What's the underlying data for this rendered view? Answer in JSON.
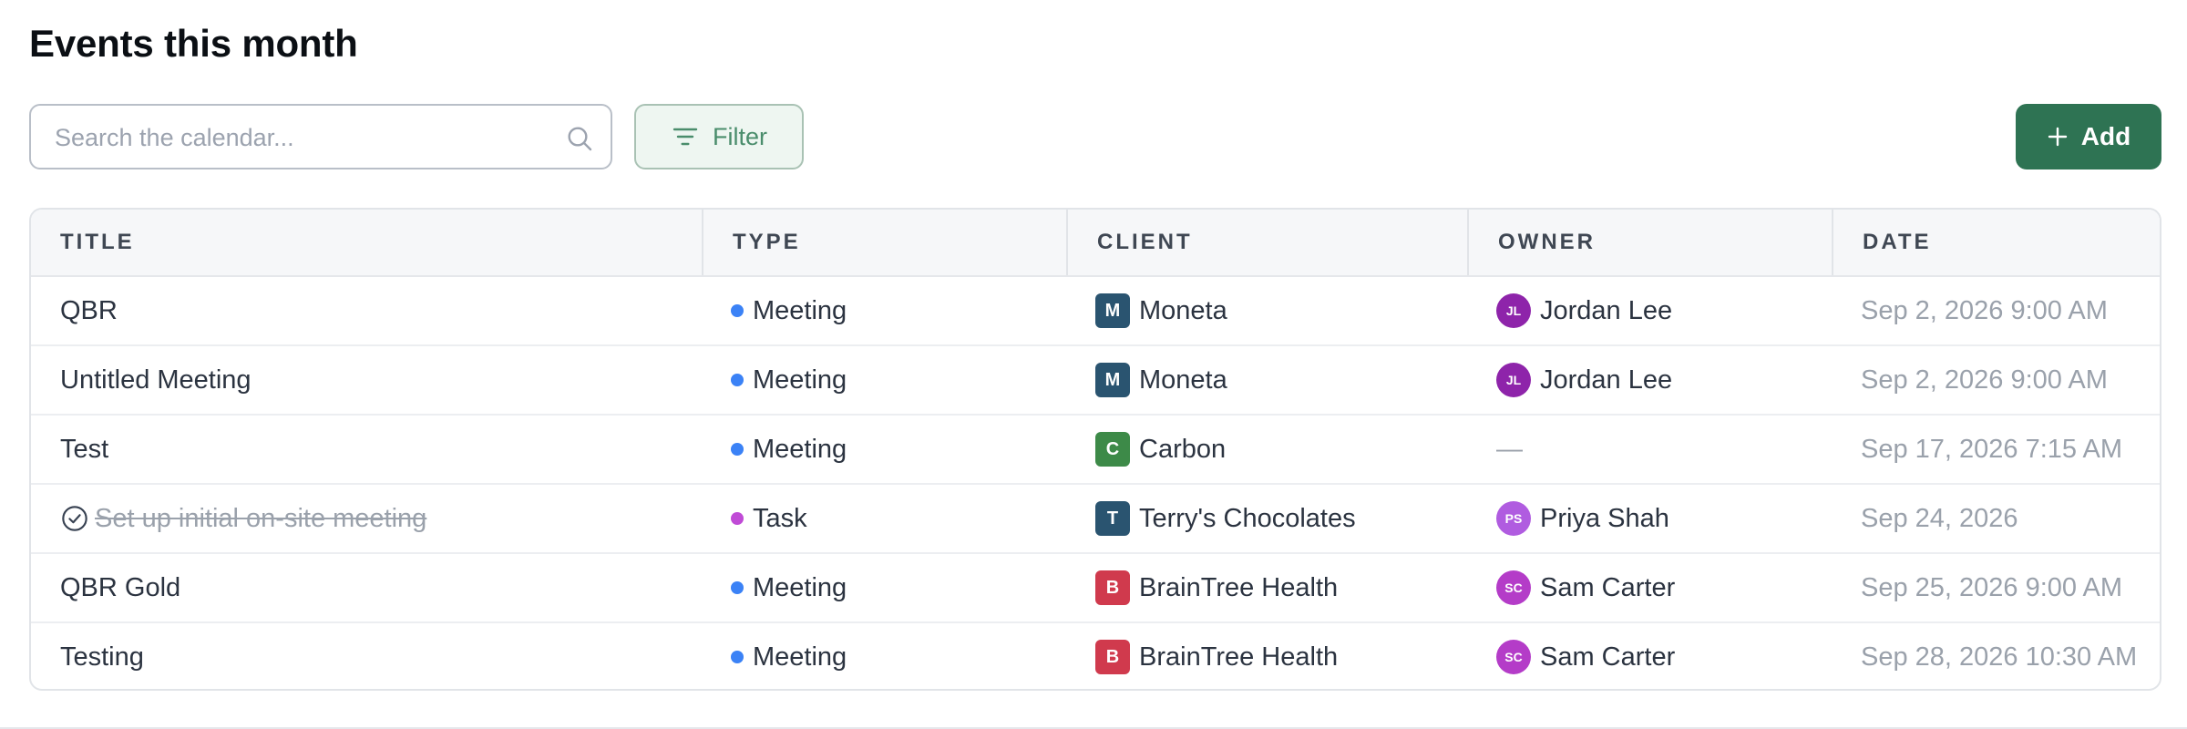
{
  "page": {
    "title": "Events this month"
  },
  "toolbar": {
    "search_placeholder": "Search the calendar...",
    "search_icon": "search-icon",
    "filter_label": "Filter",
    "filter_icon": "filter-lines-icon",
    "add_label": "Add",
    "add_icon": "plus-icon"
  },
  "colors": {
    "accent": "#2e7353",
    "meeting": "#3b82f6",
    "task": "#c04bd6"
  },
  "table": {
    "headers": {
      "title": "TITLE",
      "type": "TYPE",
      "client": "CLIENT",
      "owner": "OWNER",
      "date": "DATE"
    },
    "rows": [
      {
        "title": "QBR",
        "completed": false,
        "type": "Meeting",
        "type_color": "#3b82f6",
        "client_initial": "M",
        "client": "Moneta",
        "client_color": "#2a5470",
        "owner_initials": "JL",
        "owner": "Jordan Lee",
        "owner_color": "#8e24aa",
        "date": "Sep 2, 2026 9:00 AM"
      },
      {
        "title": "Untitled Meeting",
        "completed": false,
        "type": "Meeting",
        "type_color": "#3b82f6",
        "client_initial": "M",
        "client": "Moneta",
        "client_color": "#2a5470",
        "owner_initials": "JL",
        "owner": "Jordan Lee",
        "owner_color": "#8e24aa",
        "date": "Sep 2, 2026 9:00 AM"
      },
      {
        "title": "Test",
        "completed": false,
        "type": "Meeting",
        "type_color": "#3b82f6",
        "client_initial": "C",
        "client": "Carbon",
        "client_color": "#3d8a48",
        "owner_initials": "",
        "owner": "—",
        "owner_color": "",
        "date": "Sep 17, 2026 7:15 AM"
      },
      {
        "title": "Set up initial on-site meeting",
        "completed": true,
        "type": "Task",
        "type_color": "#c04bd6",
        "client_initial": "T",
        "client": "Terry's Chocolates",
        "client_color": "#2a5470",
        "owner_initials": "PS",
        "owner": "Priya Shah",
        "owner_color": "#b05ce0",
        "date": "Sep 24, 2026"
      },
      {
        "title": "QBR Gold",
        "completed": false,
        "type": "Meeting",
        "type_color": "#3b82f6",
        "client_initial": "B",
        "client": "BrainTree Health",
        "client_color": "#d03a4d",
        "owner_initials": "SC",
        "owner": "Sam Carter",
        "owner_color": "#b43cc8",
        "date": "Sep 25, 2026 9:00 AM"
      },
      {
        "title": "Testing",
        "completed": false,
        "type": "Meeting",
        "type_color": "#3b82f6",
        "client_initial": "B",
        "client": "BrainTree Health",
        "client_color": "#d03a4d",
        "owner_initials": "SC",
        "owner": "Sam Carter",
        "owner_color": "#b43cc8",
        "date": "Sep 28, 2026 10:30 AM"
      }
    ]
  }
}
